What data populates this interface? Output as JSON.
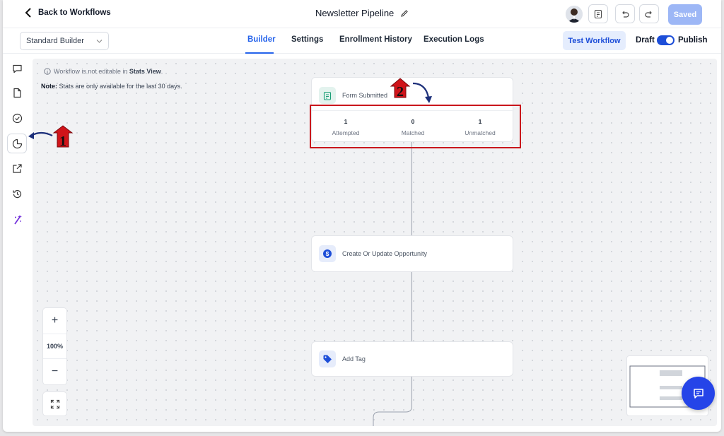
{
  "header": {
    "back_label": "Back to Workflows",
    "workflow_name": "Newsletter Pipeline",
    "saved_label": "Saved"
  },
  "subheader": {
    "builder_select": "Standard Builder",
    "tabs": [
      {
        "label": "Builder",
        "active": true
      },
      {
        "label": "Settings",
        "active": false
      },
      {
        "label": "Enrollment History",
        "active": false
      },
      {
        "label": "Execution Logs",
        "active": false
      }
    ],
    "test_label": "Test Workflow",
    "draft_label": "Draft",
    "publish_label": "Publish",
    "publish_on": true
  },
  "rail": {
    "icons": [
      "chat-icon",
      "document-icon",
      "check-circle-icon",
      "stats-pie-icon",
      "external-link-icon",
      "history-icon",
      "ai-sparkle-icon"
    ],
    "active": "stats-pie-icon"
  },
  "canvas": {
    "notice_prefix": "Workflow is not editable in",
    "notice_bold": "Stats View",
    "notice_suffix": ".",
    "note_bold": "Note:",
    "note_text": "Stats are only available for the last 30 days.",
    "zoom": "100%",
    "trigger": {
      "label": "Form Submitted",
      "stats": [
        {
          "value": "1",
          "label": "Attempted"
        },
        {
          "value": "0",
          "label": "Matched"
        },
        {
          "value": "1",
          "label": "Unmatched"
        }
      ]
    },
    "actions": [
      {
        "label": "Create Or Update Opportunity",
        "icon": "dollar-icon"
      },
      {
        "label": "Add Tag",
        "icon": "tag-icon"
      }
    ]
  },
  "annotations": {
    "step1": "1",
    "step2": "2"
  },
  "colors": {
    "primary": "#2563eb",
    "highlight": "#c9161c",
    "marker": "#d0141a"
  }
}
